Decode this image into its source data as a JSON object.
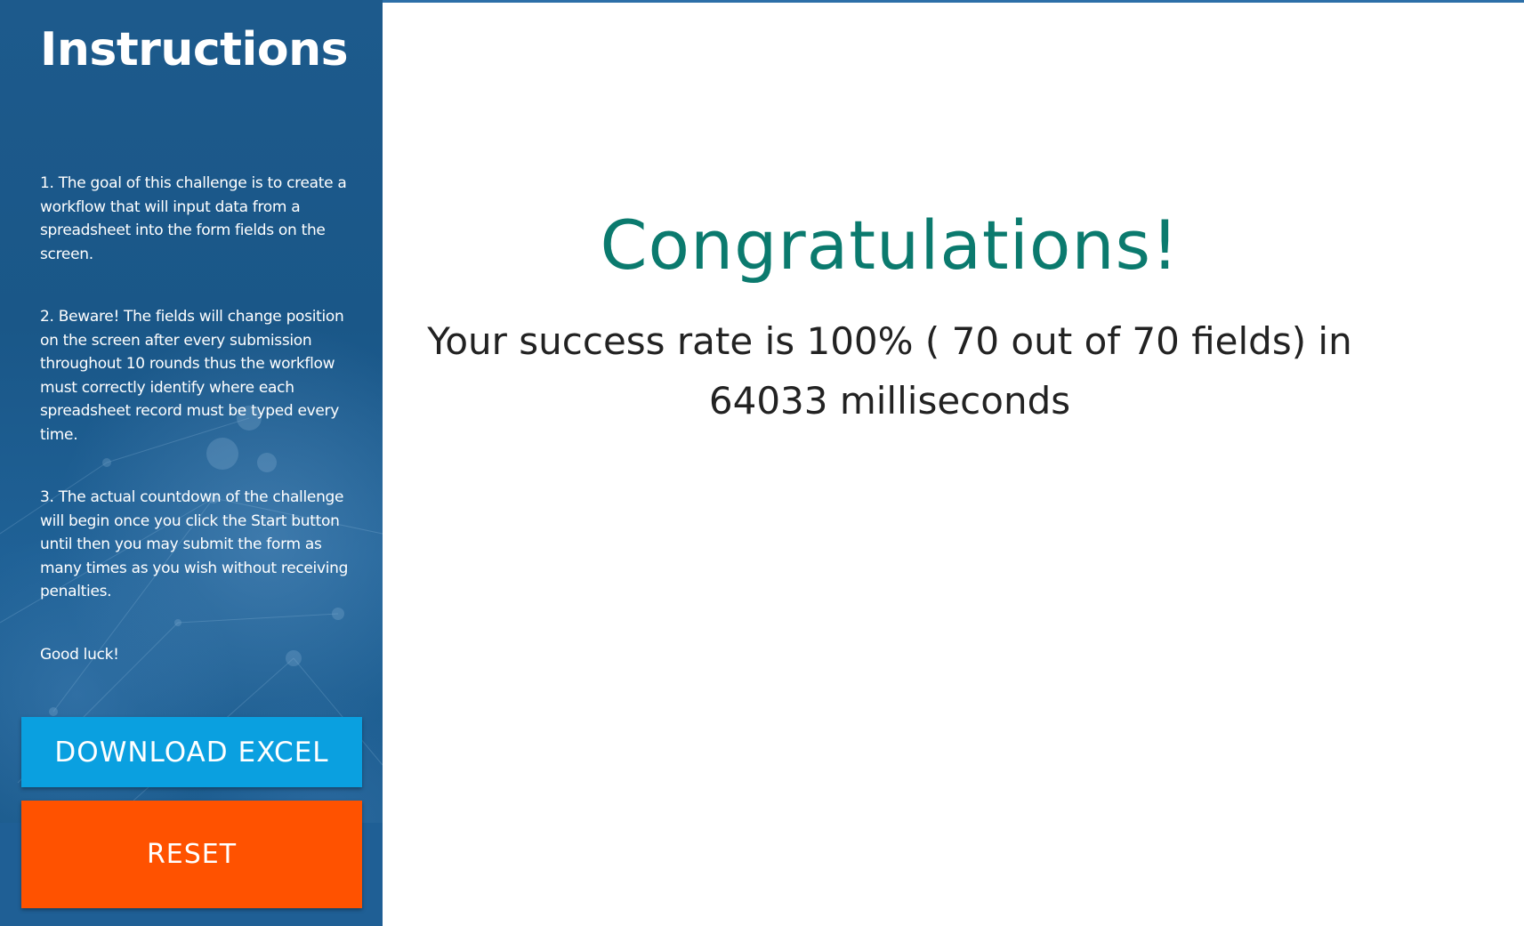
{
  "sidebar": {
    "title": "Instructions",
    "paragraphs": [
      "1. The goal of this challenge is to create a workflow that will input data from a spreadsheet into the form fields on the screen.",
      "2. Beware! The fields will change position on the screen after every submission throughout 10 rounds thus the workflow must correctly identify where each spreadsheet record must be typed every time.",
      "3. The actual countdown of the challenge will begin once you click the Start button until then you may submit the form as many times as you wish without receiving penalties.",
      "Good luck!"
    ],
    "download_button_label": "DOWNLOAD EXCEL",
    "reset_button_label": "RESET"
  },
  "main": {
    "heading": "Congratulations!",
    "message": "Your success rate is 100% ( 70 out of 70 fields) in 64033 milliseconds"
  },
  "colors": {
    "sidebar_background": "#1d5b8c",
    "heading_color": "#0b7a6e",
    "download_button": "#0aa0e0",
    "reset_button": "#ff5200",
    "top_accent": "#2c6fa8"
  }
}
